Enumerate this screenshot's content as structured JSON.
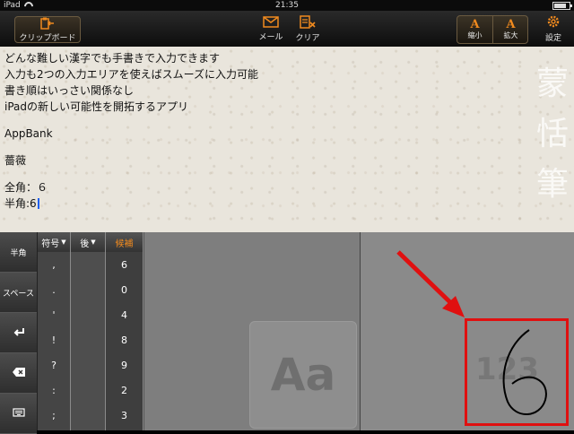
{
  "status": {
    "device": "iPad",
    "time": "21:35"
  },
  "toolbar": {
    "clipboard_label": "クリップボード",
    "mail_label": "メール",
    "clear_label": "クリア",
    "shrink_glyph": "A",
    "shrink_label": "縮小",
    "enlarge_glyph": "A",
    "enlarge_label": "拡大",
    "settings_label": "設定"
  },
  "editor": {
    "lines": [
      "どんな難しい漢字でも手書きで入力できます",
      "入力も2つの入力エリアを使えばスムーズに入力可能",
      "書き順はいっさい関係なし",
      "iPadの新しい可能性を開拓するアプリ",
      "AppBank",
      "薔薇",
      "全角：６",
      "半角:6"
    ],
    "seal_chars": [
      "蒙",
      "恬",
      "筆"
    ]
  },
  "keyboard": {
    "left_keys": [
      "半角",
      "スペース"
    ],
    "symbols_label": "符号",
    "back_label": "後",
    "candidates_label": "候補",
    "symbols": [
      ",",
      ".",
      "'",
      "!",
      "?",
      ":",
      ";"
    ],
    "candidates": [
      "6",
      "0",
      "4",
      "8",
      "9",
      "2",
      "3"
    ],
    "pad1_label": "Aa",
    "pad2_label": "123",
    "handwritten_value": "6"
  },
  "colors": {
    "accent": "#f08a1e",
    "highlight": "#e01010",
    "caret": "#1d5ef0"
  }
}
